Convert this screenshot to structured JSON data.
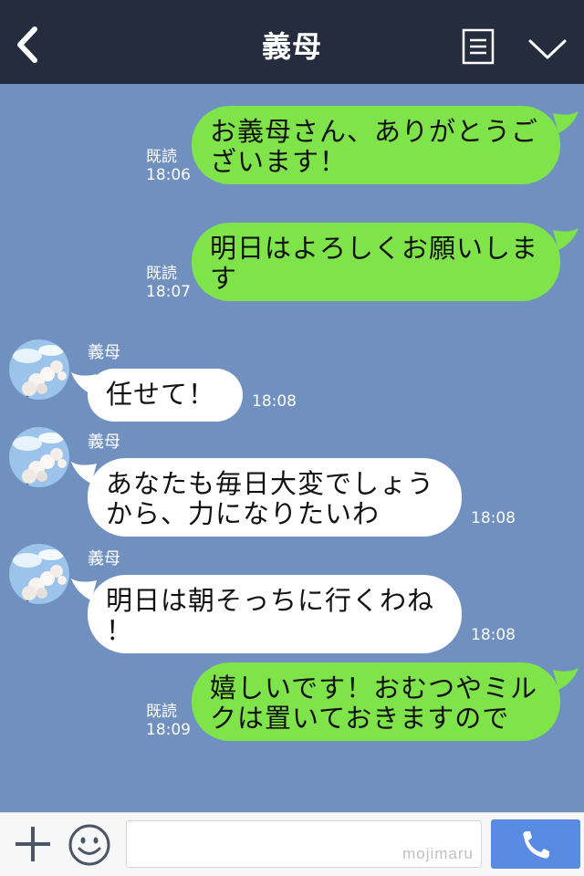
{
  "header": {
    "title": "義母",
    "back_icon": "chevron-left-icon",
    "menu_icon": "list-icon",
    "collapse_icon": "chevron-down-icon"
  },
  "messages": [
    {
      "dir": "out",
      "lines": [
        "お義母さん、ありがとうご",
        "ざいます！"
      ],
      "read": "既読",
      "time": "18:06"
    },
    {
      "dir": "out",
      "lines": [
        "明日はよろしくお願いしま",
        "す"
      ],
      "read": "既読",
      "time": "18:07"
    },
    {
      "dir": "in",
      "sender": "義母",
      "lines": [
        "任せて！"
      ],
      "time": "18:08"
    },
    {
      "dir": "in",
      "sender": "義母",
      "lines": [
        "あなたも毎日大変でしょう",
        "から、力になりたいわ"
      ],
      "time": "18:08"
    },
    {
      "dir": "in",
      "sender": "義母",
      "lines": [
        "明日は朝そっちに行くわね",
        "！"
      ],
      "time": "18:08"
    },
    {
      "dir": "out",
      "lines": [
        "嬉しいです！おむつやミル",
        "クは置いておきますので"
      ],
      "read": "既読",
      "time": "18:09"
    }
  ],
  "footer": {
    "plus_icon": "plus-icon",
    "emoji_icon": "smiley-icon",
    "input_value": "",
    "watermark": "mojimaru",
    "call_icon": "phone-icon"
  },
  "colors": {
    "header_bg": "#242c3e",
    "chat_bg": "#7090c0",
    "outgoing_bubble": "#7fe34a",
    "incoming_bubble": "#ffffff",
    "call_button": "#5a8be2"
  }
}
